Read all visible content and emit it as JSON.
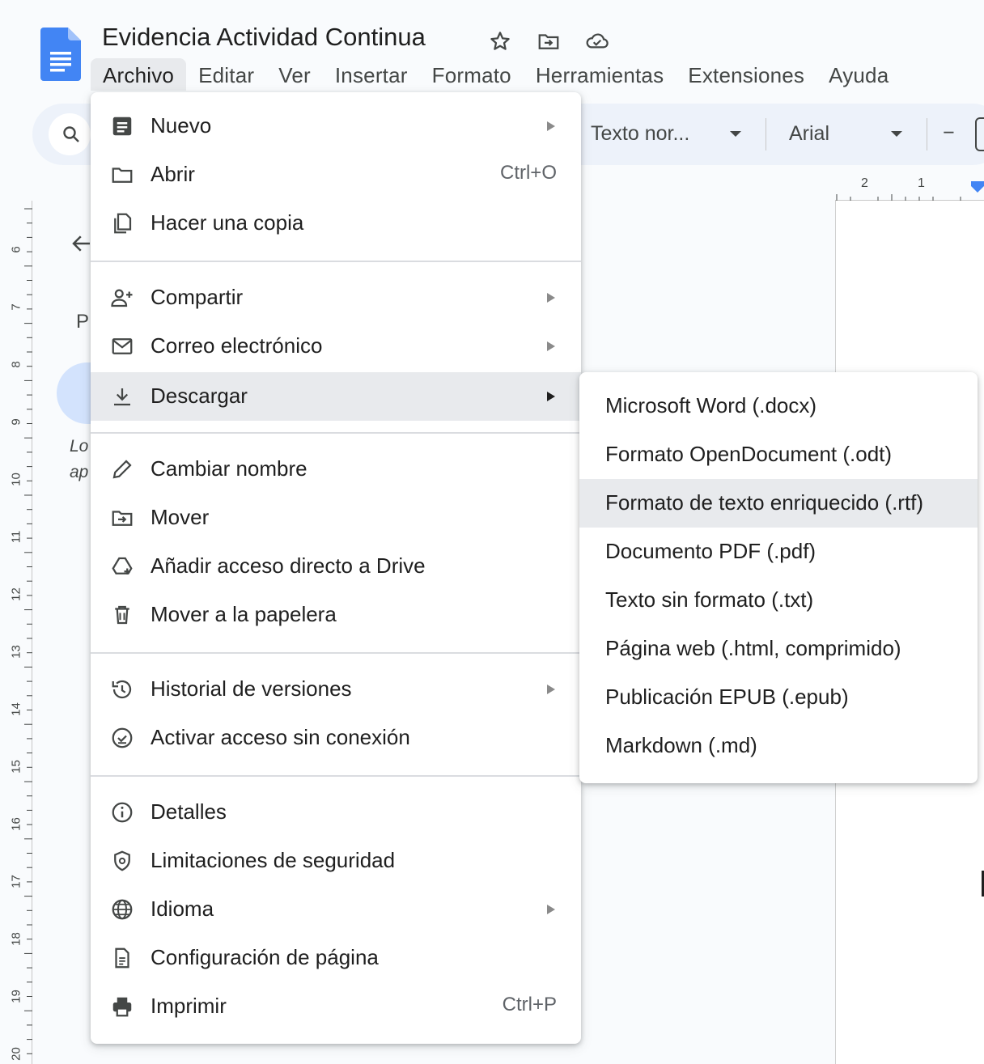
{
  "doc": {
    "title": "Evidencia Actividad Continua",
    "title_icons": [
      "star-icon",
      "move-folder-icon",
      "cloud-saved-icon"
    ]
  },
  "menubar": {
    "items": [
      {
        "label": "Archivo"
      },
      {
        "label": "Editar"
      },
      {
        "label": "Ver"
      },
      {
        "label": "Insertar"
      },
      {
        "label": "Formato"
      },
      {
        "label": "Herramientas"
      },
      {
        "label": "Extensiones"
      },
      {
        "label": "Ayuda"
      }
    ],
    "active": "Archivo"
  },
  "toolbar": {
    "style_value": "Texto nor...",
    "font_value": "Arial",
    "font_size_minus": "−"
  },
  "outline_partial": {
    "p": "P",
    "lo": "Lo",
    "ap": "ap"
  },
  "ruler": {
    "vertical": [
      "6",
      "7",
      "8",
      "9",
      "10",
      "11",
      "12",
      "13",
      "14",
      "15",
      "16",
      "17",
      "18",
      "19",
      "20"
    ],
    "horizontal": [
      "2",
      "1"
    ]
  },
  "file_menu": {
    "items": [
      {
        "label": "Nuevo",
        "icon": "document-icon",
        "submenu": true
      },
      {
        "label": "Abrir",
        "icon": "folder-icon",
        "shortcut": "Ctrl+O"
      },
      {
        "label": "Hacer una copia",
        "icon": "copy-icon"
      },
      {
        "label": "Compartir",
        "icon": "person-add-icon",
        "submenu": true
      },
      {
        "label": "Correo electrónico",
        "icon": "mail-icon",
        "submenu": true
      },
      {
        "label": "Descargar",
        "icon": "download-icon",
        "submenu": true,
        "highlighted": true
      },
      {
        "label": "Cambiar nombre",
        "icon": "pencil-icon"
      },
      {
        "label": "Mover",
        "icon": "move-folder-icon"
      },
      {
        "label": "Añadir acceso directo a Drive",
        "icon": "drive-shortcut-icon"
      },
      {
        "label": "Mover a la papelera",
        "icon": "trash-icon"
      },
      {
        "label": "Historial de versiones",
        "icon": "history-icon",
        "submenu": true
      },
      {
        "label": "Activar acceso sin conexión",
        "icon": "offline-icon"
      },
      {
        "label": "Detalles",
        "icon": "info-icon"
      },
      {
        "label": "Limitaciones de seguridad",
        "icon": "security-icon"
      },
      {
        "label": "Idioma",
        "icon": "globe-icon",
        "submenu": true
      },
      {
        "label": "Configuración de página",
        "icon": "page-setup-icon"
      },
      {
        "label": "Imprimir",
        "icon": "printer-icon",
        "shortcut": "Ctrl+P"
      }
    ]
  },
  "download_submenu": {
    "items": [
      {
        "label": "Microsoft Word (.docx)"
      },
      {
        "label": "Formato OpenDocument (.odt)"
      },
      {
        "label": "Formato de texto enriquecido (.rtf)",
        "highlighted": true
      },
      {
        "label": "Documento PDF (.pdf)"
      },
      {
        "label": "Texto sin formato (.txt)"
      },
      {
        "label": "Página web (.html, comprimido)"
      },
      {
        "label": "Publicación EPUB (.epub)"
      },
      {
        "label": "Markdown (.md)"
      }
    ]
  },
  "colors": {
    "docs_blue": "#4285f4",
    "menu_highlight": "#e8eaed",
    "toolbar_bg": "#edf2fa"
  }
}
